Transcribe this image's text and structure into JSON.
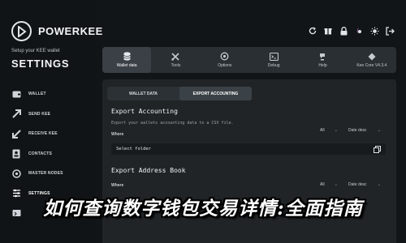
{
  "app": {
    "logo_text": "POWERKEE",
    "tagline": "Setup your KEE wallet",
    "section_title": "SETTINGS"
  },
  "sidebar": {
    "items": [
      {
        "label": "WALLET",
        "icon": "wallet-icon"
      },
      {
        "label": "SEND KEE",
        "icon": "send-icon"
      },
      {
        "label": "RECEIVE KEE",
        "icon": "receive-icon"
      },
      {
        "label": "CONTACTS",
        "icon": "contacts-icon"
      },
      {
        "label": "MASTER NODES",
        "icon": "master-nodes-icon"
      },
      {
        "label": "SETTINGS",
        "icon": "settings-icon",
        "active": true
      },
      {
        "label": "",
        "icon": "tools-icon"
      }
    ]
  },
  "top_icons": [
    "refresh-icon",
    "gift-icon",
    "lock-icon",
    "toggle-icon",
    "sun-icon",
    "exit-icon"
  ],
  "main_tabs": [
    {
      "label": "Wallet data",
      "icon": "database-icon",
      "active": true
    },
    {
      "label": "Tools",
      "icon": "tools-icon"
    },
    {
      "label": "Options",
      "icon": "options-icon"
    },
    {
      "label": "Debug",
      "icon": "debug-icon"
    },
    {
      "label": "Help",
      "icon": "help-icon"
    },
    {
      "label": "Kee Core V4.3.4",
      "icon": "core-icon"
    }
  ],
  "sub_tabs": [
    {
      "label": "WALLET DATA"
    },
    {
      "label": "EXPORT ACCOUNTING",
      "active": true
    }
  ],
  "export_accounting": {
    "title": "Export Accounting",
    "description": "Export your wallets accounting data to a CSV file.",
    "where_label": "Where",
    "filter_value": "All",
    "sort_value": "Date desc",
    "folder_value": "Select folder"
  },
  "export_address_book": {
    "title": "Export Address Book",
    "where_label": "Where",
    "filter_value": "All",
    "sort_value": "Date desc"
  },
  "overlay": {
    "headline": "如何查询数字钱包交易详情:全面指南"
  },
  "colors": {
    "background": "#121517",
    "panel": "#202427",
    "tab_bar": "#2a2f33",
    "text": "#e8ecef"
  }
}
